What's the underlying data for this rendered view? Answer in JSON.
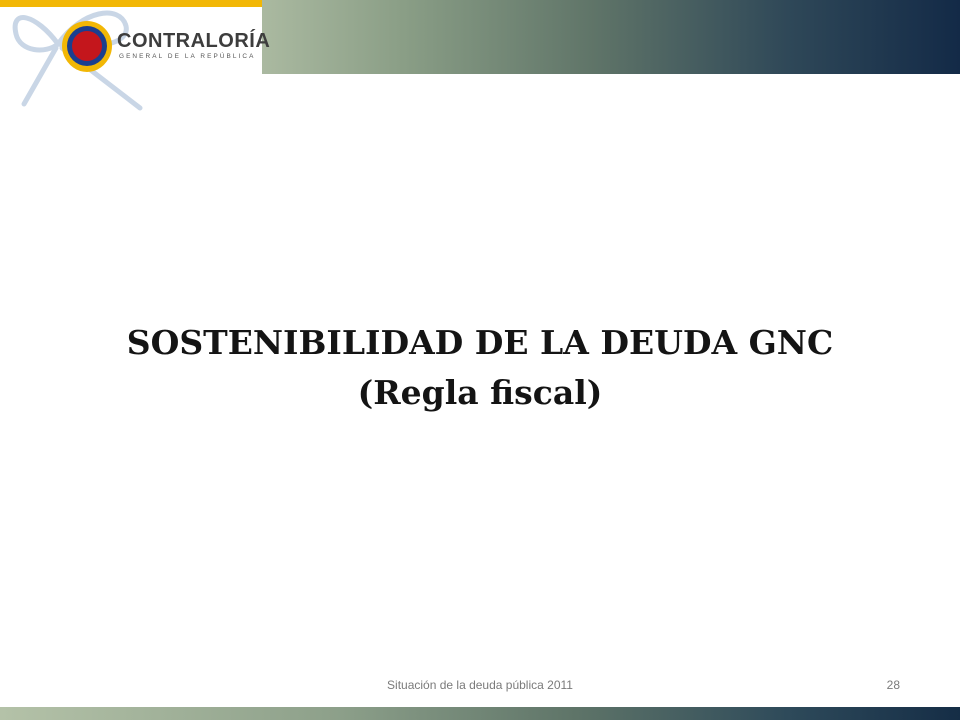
{
  "header": {
    "logo_name": "CONTRALORÍA",
    "logo_subtitle": "GENERAL DE LA REPÚBLICA"
  },
  "slide": {
    "title_line1": "SOSTENIBILIDAD DE LA DEUDA GNC",
    "title_line2": "(Regla fiscal)"
  },
  "footer": {
    "text": "Situación de la deuda pública 2011",
    "page_number": "28"
  },
  "colors": {
    "gold": "#f2b705",
    "navy": "#132a47",
    "seal_red": "#c4161c",
    "seal_blue": "#1b3f8f"
  },
  "icons": {
    "ribbon": "ribbon-icon",
    "seal": "seal-icon"
  }
}
